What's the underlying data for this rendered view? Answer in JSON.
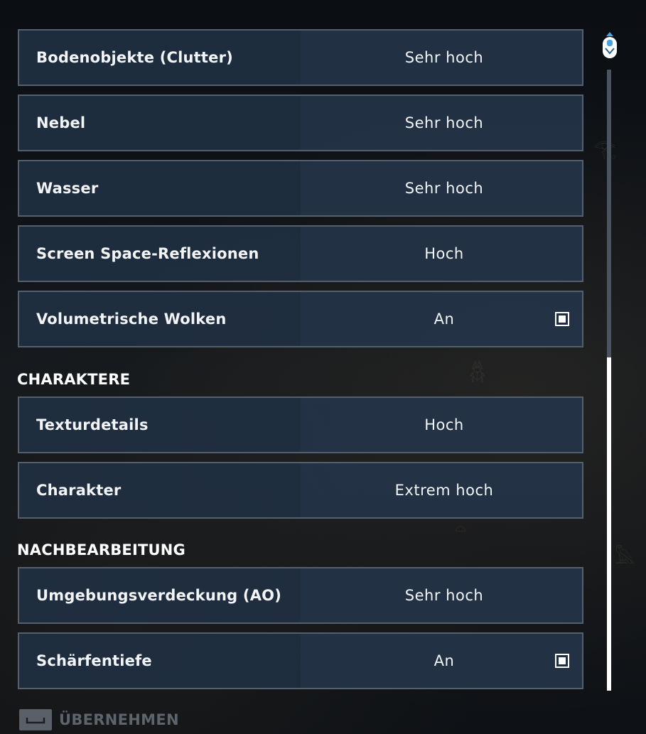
{
  "rows_top": [
    {
      "label": "Bodenobjekte (Clutter)",
      "value": "Sehr hoch",
      "checkbox": false
    },
    {
      "label": "Nebel",
      "value": "Sehr hoch",
      "checkbox": false
    },
    {
      "label": "Wasser",
      "value": "Sehr hoch",
      "checkbox": false
    },
    {
      "label": "Screen Space-Reflexionen",
      "value": "Hoch",
      "checkbox": false
    },
    {
      "label": "Volumetrische Wolken",
      "value": "An",
      "checkbox": true
    }
  ],
  "sections": {
    "characters": {
      "title": "CHARAKTERE",
      "rows": [
        {
          "label": "Texturdetails",
          "value": "Hoch",
          "checkbox": false
        },
        {
          "label": "Charakter",
          "value": "Extrem hoch",
          "checkbox": false
        }
      ]
    },
    "postprocessing": {
      "title": "NACHBEARBEITUNG",
      "rows": [
        {
          "label": "Umgebungsverdeckung (AO)",
          "value": "Sehr hoch",
          "checkbox": false
        },
        {
          "label": "Schärfentiefe",
          "value": "An",
          "checkbox": true
        }
      ]
    }
  },
  "footer": {
    "apply_label": "ÜBERNEHMEN",
    "apply_key_icon": "spacebar-key-icon"
  },
  "scrollbar": {
    "icon": "mouse-scroll-icon",
    "thumb_start_fraction": 0.46,
    "thumb_size_fraction": 0.54
  },
  "colors": {
    "row_bg": "#1f2e40",
    "row_border": "#54606e",
    "text": "#f2f4f6",
    "footer_text": "#5e646c"
  }
}
